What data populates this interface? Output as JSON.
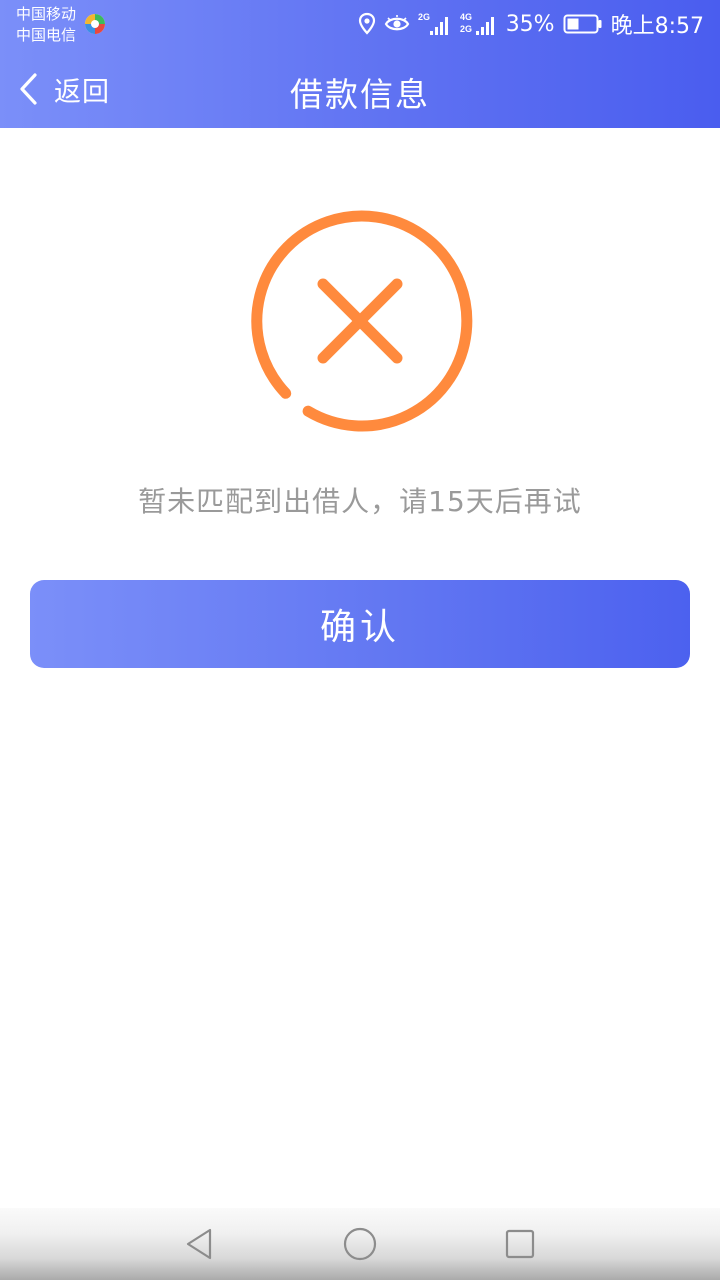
{
  "status_bar": {
    "carrier_1": "中国移动",
    "carrier_2": "中国电信",
    "network_1": "2G",
    "network_2a": "4G",
    "network_2b": "2G",
    "battery_percent": "35%",
    "time": "晚上8:57"
  },
  "nav": {
    "back_label": "返回",
    "title": "借款信息"
  },
  "result": {
    "message": "暂未匹配到出借人，请15天后再试"
  },
  "actions": {
    "confirm_label": "确认"
  },
  "colors": {
    "header_gradient_start": "#7b8ff9",
    "header_gradient_end": "#4a5def",
    "error_orange": "#ff8a3d",
    "message_gray": "#9a9a9a"
  },
  "icons": {
    "back": "chevron-left-icon",
    "result": "error-circle-x-icon",
    "location": "location-pin-icon",
    "eye": "eye-icon",
    "sys_back": "triangle-back-icon",
    "sys_home": "circle-home-icon",
    "sys_recent": "square-recent-icon"
  }
}
